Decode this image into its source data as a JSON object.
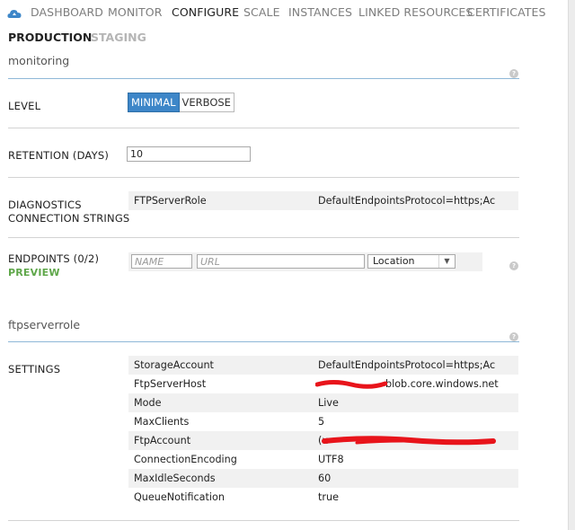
{
  "nav": {
    "items": [
      {
        "label": "DASHBOARD",
        "active": false
      },
      {
        "label": "MONITOR",
        "active": false
      },
      {
        "label": "CONFIGURE",
        "active": true
      },
      {
        "label": "SCALE",
        "active": false
      },
      {
        "label": "INSTANCES",
        "active": false
      },
      {
        "label": "LINKED RESOURCES",
        "active": false
      },
      {
        "label": "CERTIFICATES",
        "active": false
      }
    ],
    "icon": "cloud-service-icon"
  },
  "env_tabs": [
    {
      "label": "PRODUCTION",
      "active": true
    },
    {
      "label": "STAGING",
      "active": false
    }
  ],
  "monitoring": {
    "title": "monitoring",
    "level_label": "LEVEL",
    "level_options": [
      "MINIMAL",
      "VERBOSE"
    ],
    "level_selected": "MINIMAL",
    "retention_label": "RETENTION (DAYS)",
    "retention_value": "10",
    "diag_label_line1": "DIAGNOSTICS",
    "diag_label_line2": "CONNECTION STRINGS",
    "diag_key": "FTPServerRole",
    "diag_value": "DefaultEndpointsProtocol=https;Acco",
    "endpoints_label": "ENDPOINTS (0/2)",
    "endpoints_preview": "PREVIEW",
    "name_placeholder": "NAME",
    "url_placeholder": "URL",
    "location_selected": "Location"
  },
  "role": {
    "title": "ftpserverrole",
    "settings_label": "SETTINGS",
    "settings": [
      {
        "key": "StorageAccount",
        "value": "DefaultEndpointsProtocol=https;Acco"
      },
      {
        "key": "FtpServerHost",
        "value": "blob.core.windows.net"
      },
      {
        "key": "Mode",
        "value": "Live"
      },
      {
        "key": "MaxClients",
        "value": "5"
      },
      {
        "key": "FtpAccount",
        "value": "(u"
      },
      {
        "key": "ConnectionEncoding",
        "value": "UTF8"
      },
      {
        "key": "MaxIdleSeconds",
        "value": "60"
      },
      {
        "key": "QueueNotification",
        "value": "true"
      }
    ]
  },
  "colors": {
    "accent": "#3d86c8",
    "preview": "#5fa74a",
    "redaction": "#e8141b"
  },
  "help_icon": "question-icon"
}
